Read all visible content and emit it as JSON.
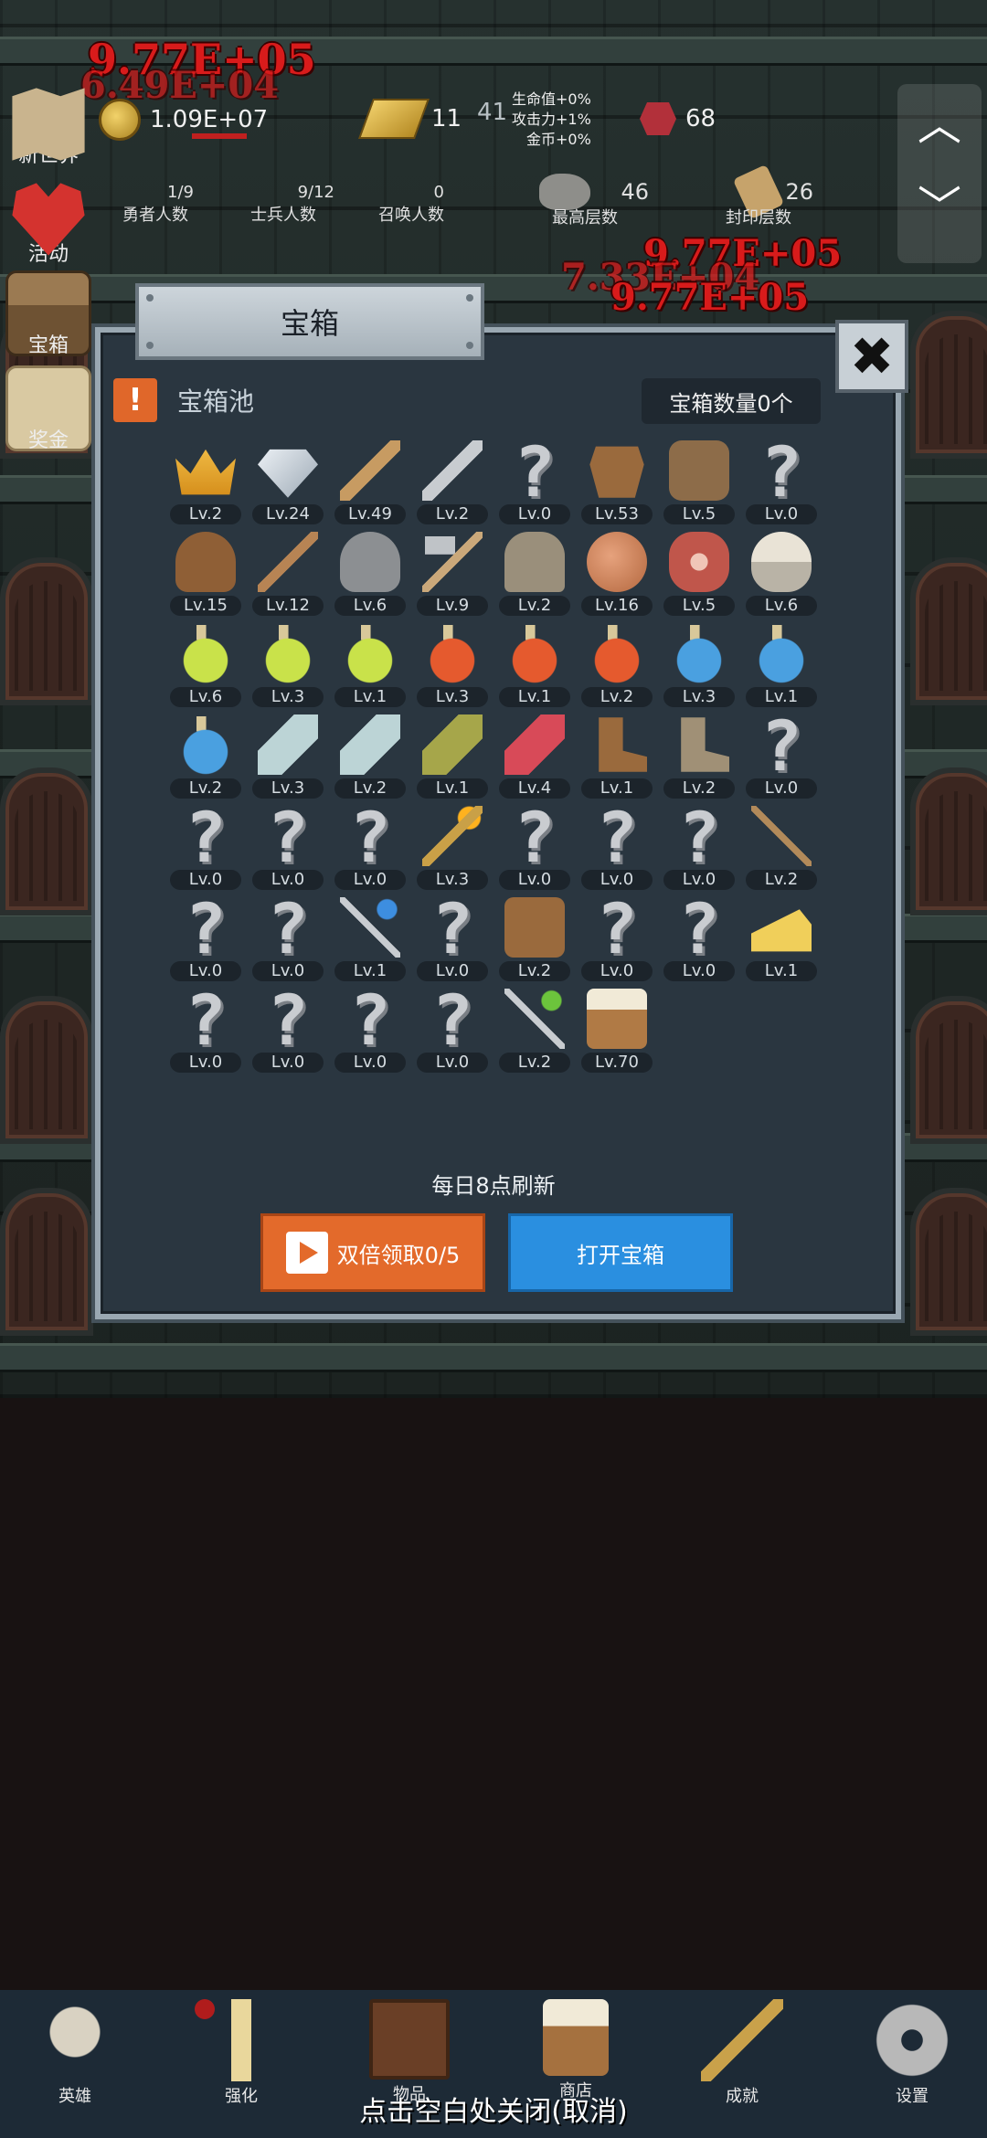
{
  "hud": {
    "gold": "1.09E+07",
    "bars": "11",
    "bars_extra": "41",
    "buffs": [
      "生命值+0%",
      "攻击力+1%",
      "金币+0%"
    ],
    "gems": "68",
    "heroes": {
      "value": "1/9",
      "label": "勇者人数"
    },
    "soldiers": {
      "value": "9/12",
      "label": "士兵人数"
    },
    "summons": {
      "value": "0",
      "label": "召唤人数"
    },
    "max_floor": {
      "value": "46",
      "label": "最高层数"
    },
    "seal_floor": {
      "value": "26",
      "label": "封印层数"
    }
  },
  "damage": [
    "9.77E+05",
    "6.49E+04",
    "9.77E+05",
    "7.33E+04",
    "9.77E+05"
  ],
  "side_menu": [
    "新世界",
    "活动",
    "宝箱",
    "奖金"
  ],
  "scroll": {
    "up": "︿",
    "down": "﹀"
  },
  "dialog": {
    "title": "宝箱",
    "close": "✖",
    "warn": "!",
    "pool_title": "宝箱池",
    "chest_count": "宝箱数量0个",
    "refresh_note": "每日8点刷新",
    "double_btn": "双倍领取0/5",
    "open_btn": "打开宝箱"
  },
  "items": [
    {
      "icon": "crown",
      "lv": "Lv.2"
    },
    {
      "icon": "diamond",
      "lv": "Lv.24"
    },
    {
      "icon": "wood-sword",
      "lv": "Lv.49"
    },
    {
      "icon": "iron-sword",
      "lv": "Lv.2"
    },
    {
      "icon": "unknown",
      "lv": "Lv.0"
    },
    {
      "icon": "leather-armor",
      "lv": "Lv.53"
    },
    {
      "icon": "backpack",
      "lv": "Lv.5"
    },
    {
      "icon": "unknown",
      "lv": "Lv.0"
    },
    {
      "icon": "leather-helmet",
      "lv": "Lv.15"
    },
    {
      "icon": "dagger",
      "lv": "Lv.12"
    },
    {
      "icon": "iron-helmet",
      "lv": "Lv.6"
    },
    {
      "icon": "hammer",
      "lv": "Lv.9"
    },
    {
      "icon": "knight-helmet",
      "lv": "Lv.2"
    },
    {
      "icon": "ham",
      "lv": "Lv.16"
    },
    {
      "icon": "steak",
      "lv": "Lv.5"
    },
    {
      "icon": "bowl",
      "lv": "Lv.6"
    },
    {
      "icon": "potion-yellow",
      "lv": "Lv.6"
    },
    {
      "icon": "potion-yellow",
      "lv": "Lv.3"
    },
    {
      "icon": "potion-yellow",
      "lv": "Lv.1"
    },
    {
      "icon": "potion-red",
      "lv": "Lv.3"
    },
    {
      "icon": "potion-red",
      "lv": "Lv.1"
    },
    {
      "icon": "potion-red",
      "lv": "Lv.2"
    },
    {
      "icon": "potion-blue",
      "lv": "Lv.3"
    },
    {
      "icon": "potion-blue",
      "lv": "Lv.1"
    },
    {
      "icon": "potion-blue",
      "lv": "Lv.2"
    },
    {
      "icon": "potion-clear",
      "lv": "Lv.3"
    },
    {
      "icon": "potion-clear",
      "lv": "Lv.2"
    },
    {
      "icon": "potion-olive",
      "lv": "Lv.1"
    },
    {
      "icon": "potion-pink",
      "lv": "Lv.4"
    },
    {
      "icon": "boot",
      "lv": "Lv.1"
    },
    {
      "icon": "boot-grey",
      "lv": "Lv.2"
    },
    {
      "icon": "unknown",
      "lv": "Lv.0"
    },
    {
      "icon": "unknown",
      "lv": "Lv.0"
    },
    {
      "icon": "unknown",
      "lv": "Lv.0"
    },
    {
      "icon": "unknown",
      "lv": "Lv.0"
    },
    {
      "icon": "torch",
      "lv": "Lv.3"
    },
    {
      "icon": "unknown",
      "lv": "Lv.0"
    },
    {
      "icon": "unknown",
      "lv": "Lv.0"
    },
    {
      "icon": "unknown",
      "lv": "Lv.0"
    },
    {
      "icon": "staff",
      "lv": "Lv.2"
    },
    {
      "icon": "unknown",
      "lv": "Lv.0"
    },
    {
      "icon": "unknown",
      "lv": "Lv.0"
    },
    {
      "icon": "blue-wand",
      "lv": "Lv.1"
    },
    {
      "icon": "unknown",
      "lv": "Lv.0"
    },
    {
      "icon": "bag",
      "lv": "Lv.2"
    },
    {
      "icon": "unknown",
      "lv": "Lv.0"
    },
    {
      "icon": "unknown",
      "lv": "Lv.0"
    },
    {
      "icon": "cheese",
      "lv": "Lv.1"
    },
    {
      "icon": "unknown",
      "lv": "Lv.0"
    },
    {
      "icon": "unknown",
      "lv": "Lv.0"
    },
    {
      "icon": "unknown",
      "lv": "Lv.0"
    },
    {
      "icon": "unknown",
      "lv": "Lv.0"
    },
    {
      "icon": "green-wand",
      "lv": "Lv.2"
    },
    {
      "icon": "beer",
      "lv": "Lv.70"
    }
  ],
  "bottom_nav": [
    {
      "label": "英雄",
      "icon": "skull-icon"
    },
    {
      "label": "强化",
      "icon": "candle-icon"
    },
    {
      "label": "物品",
      "icon": "book-icon"
    },
    {
      "label": "商店",
      "icon": "beer-mug-icon"
    },
    {
      "label": "成就",
      "icon": "key-icon"
    },
    {
      "label": "设置",
      "icon": "gear-icon"
    }
  ],
  "close_hint": "点击空白处关闭(取消)",
  "colors": {
    "accent_orange": "#e36a2b",
    "accent_blue": "#2a8fe0",
    "damage_red": "#d81b1b",
    "panel": "#2a3640"
  }
}
